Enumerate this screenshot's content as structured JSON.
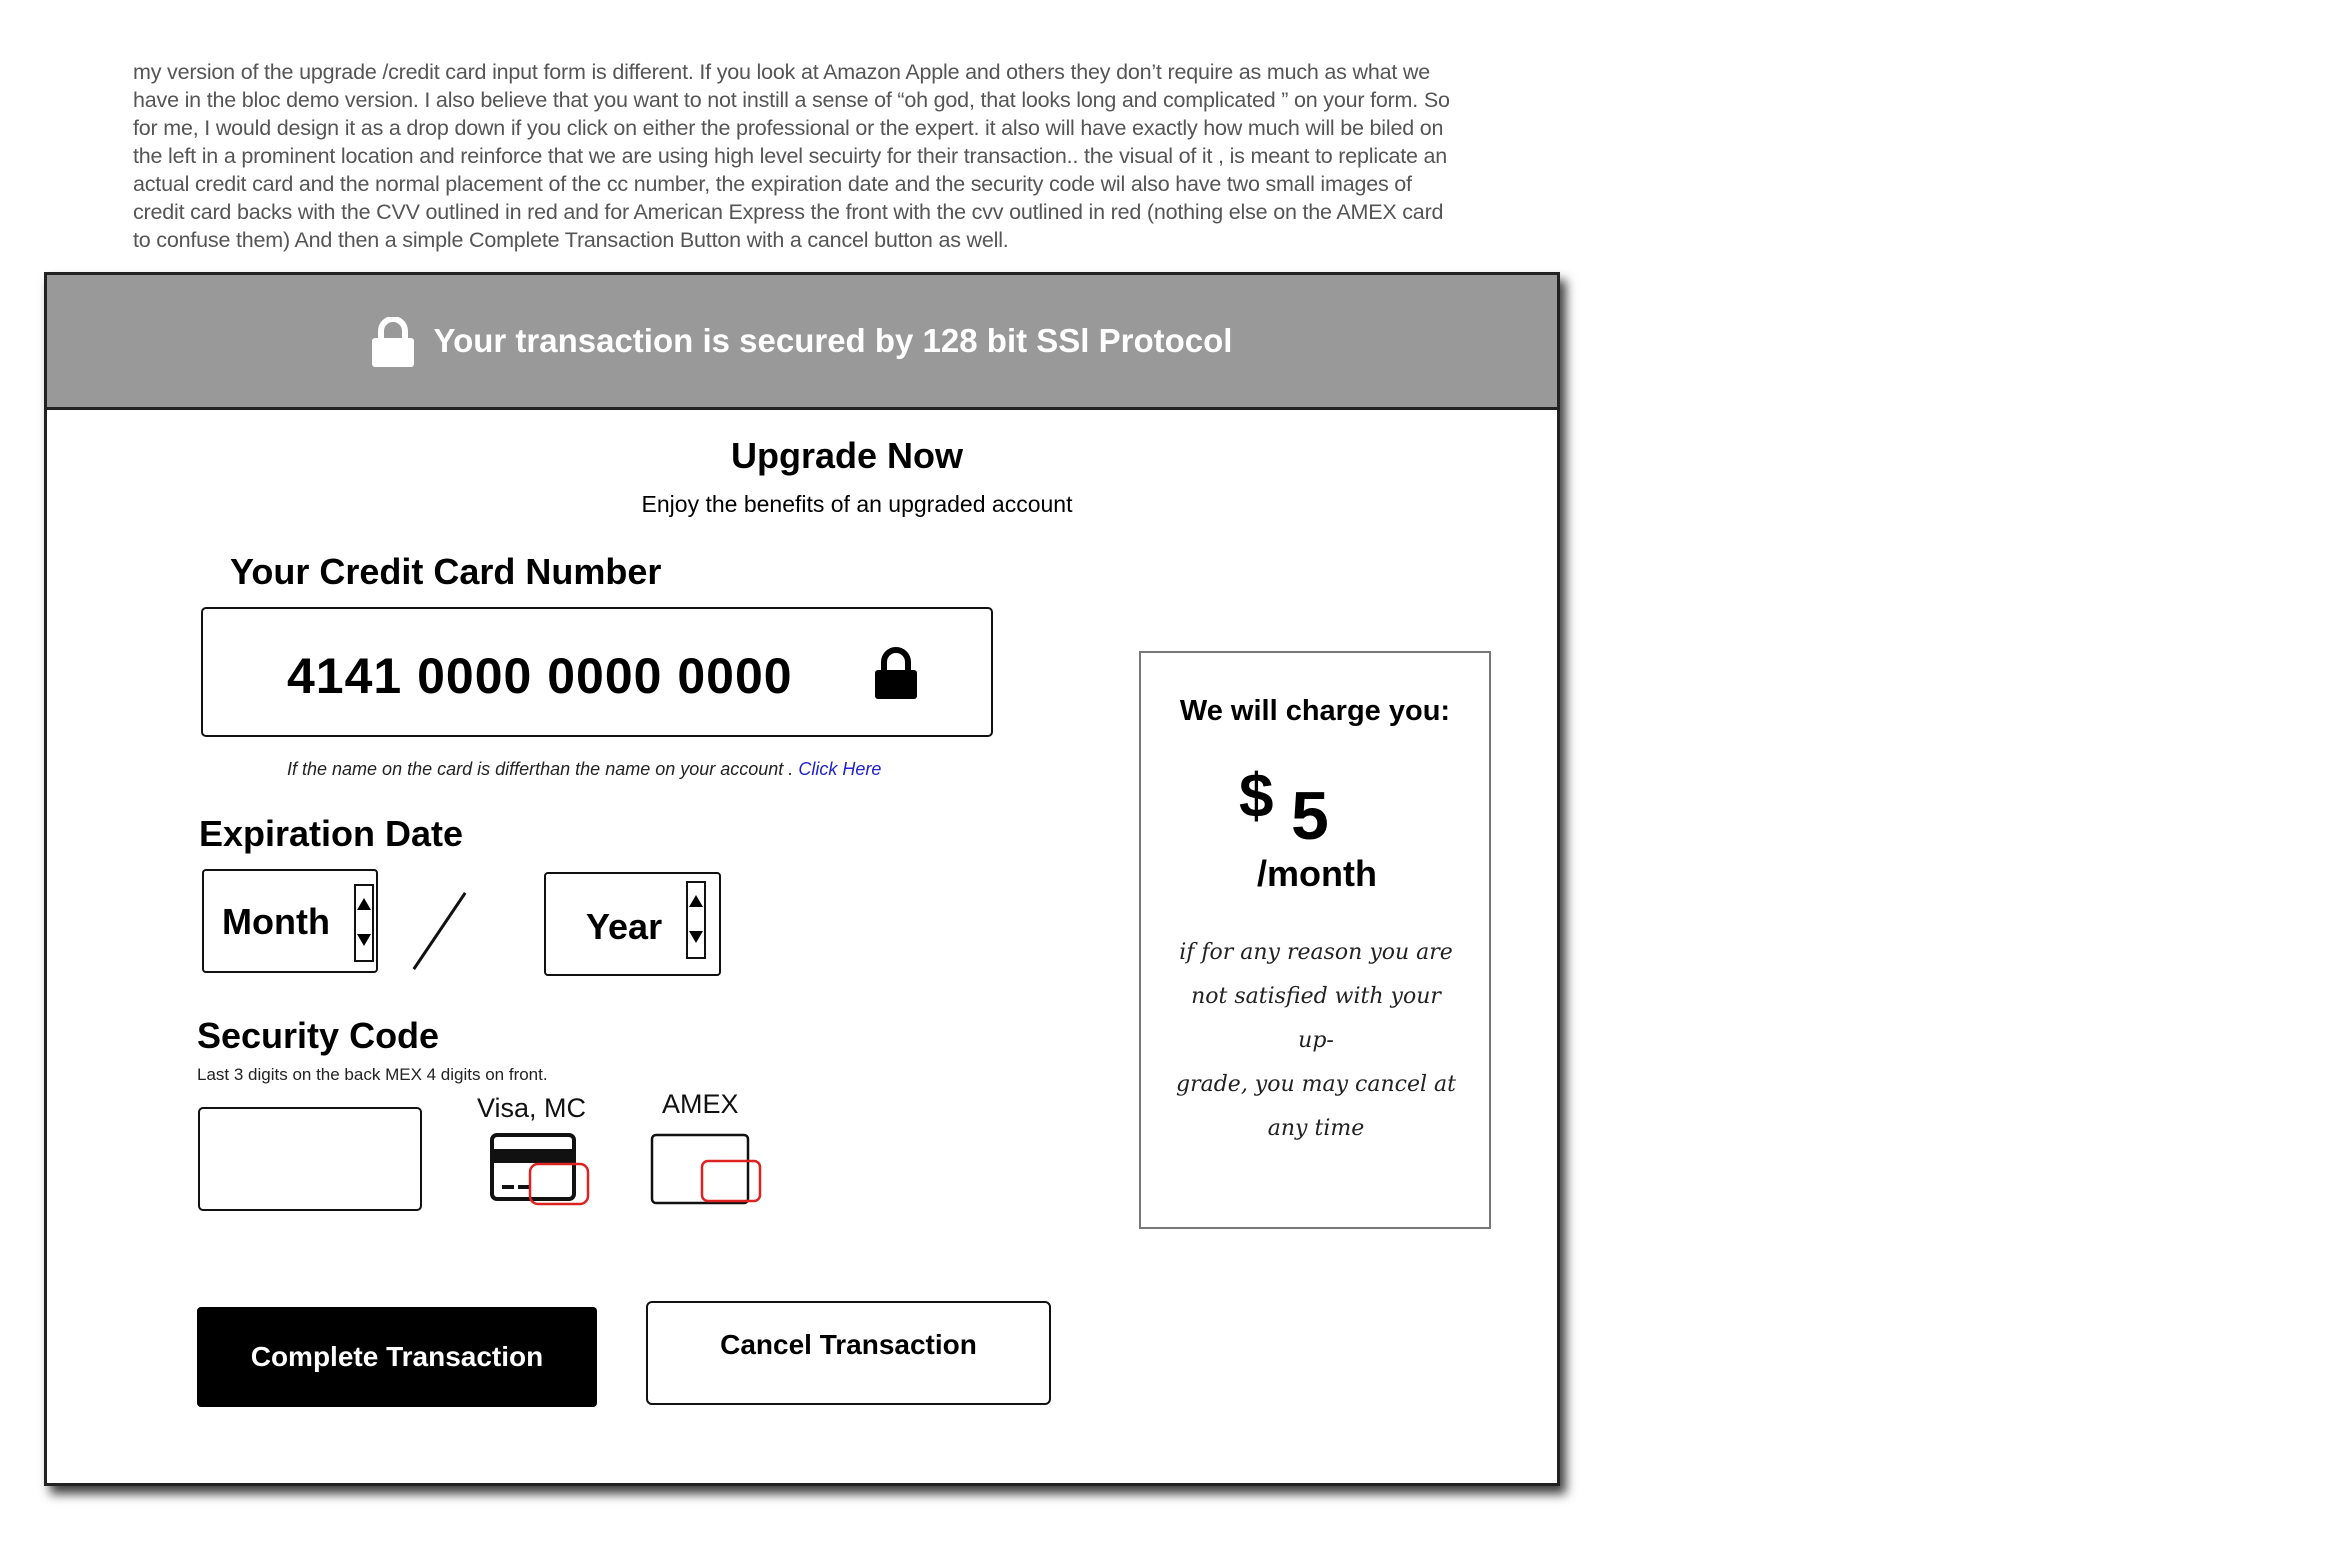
{
  "note": {
    "lines": [
      "my version of the upgrade /credit card input form is different. If you look at Amazon  Apple and others they don’t require as much as what we",
      "have in the bloc demo version. I also believe that you want to not instill a sense of “oh god, that looks long and complicated ” on  your form.  So",
      "for me,  I would design it as a drop down if you click  on either the professional or the expert. it also will have exactly how much will be biled on",
      "the left in a prominent location and reinforce that we are using high level secuirty for their transaction.. the visual of it , is meant to replicate an",
      "actual credit card and the normal placement of the cc number, the expiration date and the security code wil also have two small images of",
      "credit card backs with the CVV outlined in red and for American Express the front with the cvv outlined in red (nothing else on the AMEX card",
      "to confuse them)  And then a simple Complete Transaction Button with a cancel button as well."
    ]
  },
  "header": {
    "secure_text": "Your transaction is secured by 128 bit SSl Protocol",
    "bar_color": "#999999"
  },
  "form": {
    "title": "Upgrade Now",
    "subtitle": "Enjoy the benefits of an upgraded account",
    "cc_label": "Your Credit Card Number",
    "cc_value": "4141 0000 0000 0000",
    "name_hint": "If the name on the card is differthan the name on your account .",
    "name_hint_link": "Click Here",
    "link_color": "#2222cc",
    "expiration_label": "Expiration Date",
    "month_value": "Month",
    "year_value": "Year",
    "security_label": "Security Code",
    "security_hint": "Last 3 digits on the back MEX 4 digits on front.",
    "visa_label": "Visa, MC",
    "amex_label": "AMEX",
    "cvv_outline_color": "#dd2222",
    "complete_label": "Complete Transaction",
    "cancel_label": "Cancel Transaction"
  },
  "charge": {
    "title": "We will charge you:",
    "currency": "$",
    "amount": "5",
    "period": "/month",
    "guarantee_lines": [
      "if for any reason you are",
      "not satisfied with your up-",
      "grade, you may cancel at",
      "any time"
    ]
  },
  "icons": [
    "lock-icon",
    "lock-icon",
    "credit-card-back-icon",
    "amex-card-front-icon",
    "spinner-up-icon",
    "spinner-down-icon"
  ]
}
